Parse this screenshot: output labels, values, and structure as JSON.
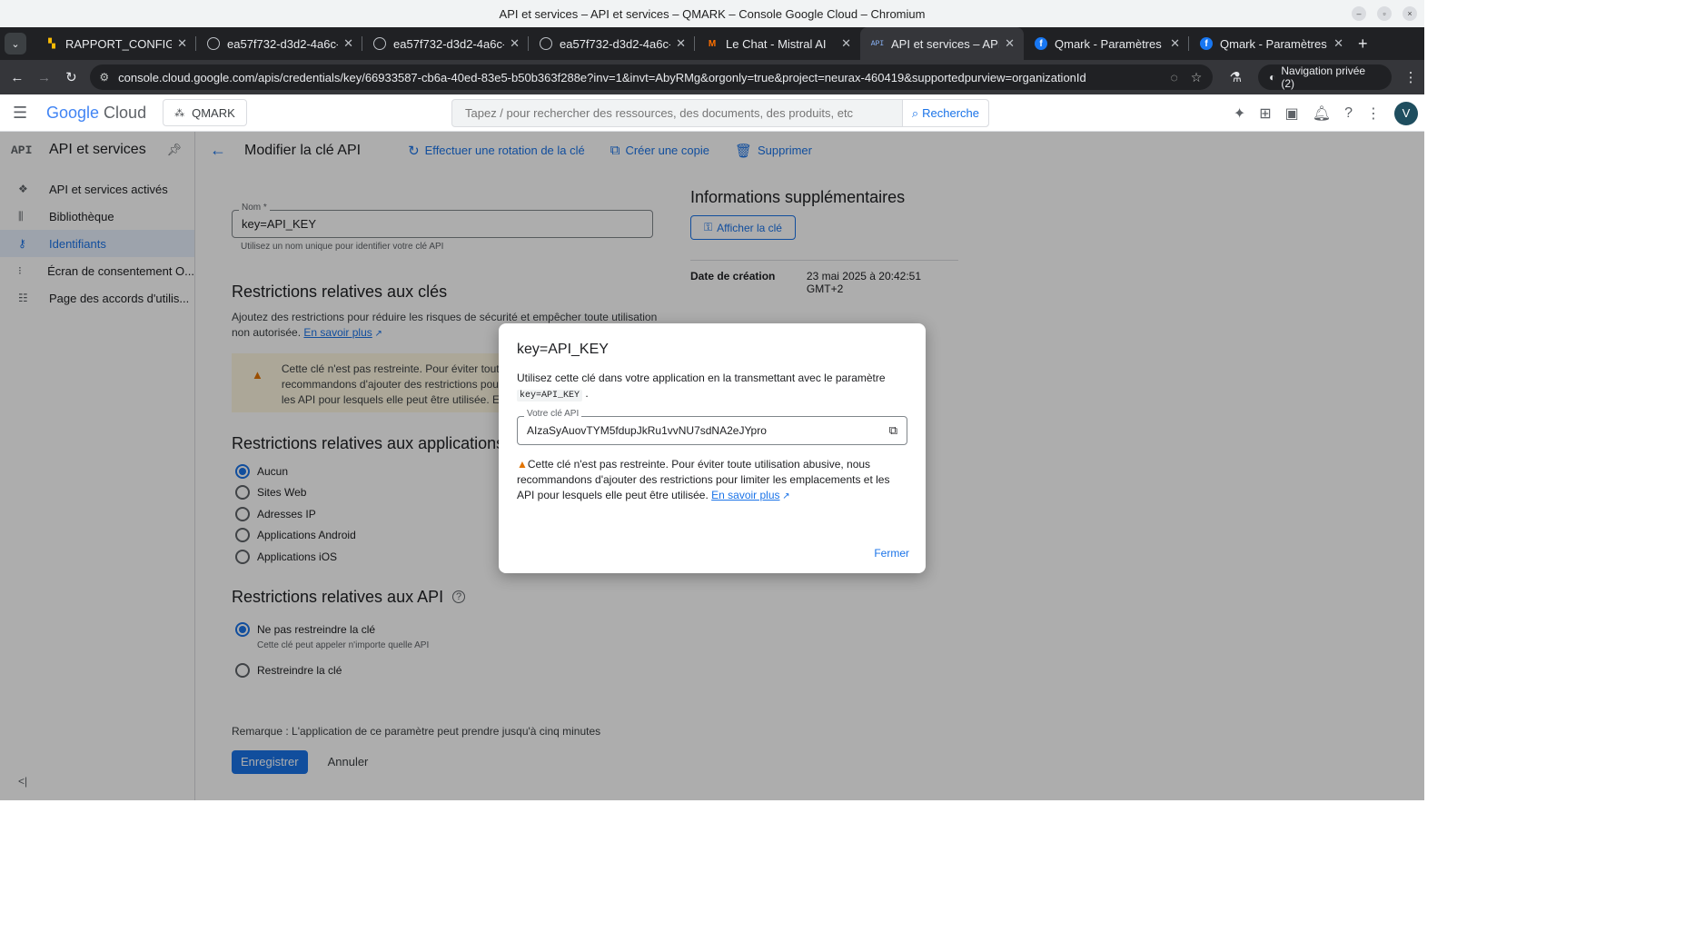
{
  "window": {
    "title": "API et services – API et services – QMARK – Console Google Cloud – Chromium"
  },
  "tabs": [
    {
      "label": "RAPPORT_CONFIGUR",
      "icon": "app-icon"
    },
    {
      "label": "ea57f732-d3d2-4a6c-",
      "icon": "globe-icon"
    },
    {
      "label": "ea57f732-d3d2-4a6c-",
      "icon": "globe-icon"
    },
    {
      "label": "ea57f732-d3d2-4a6c-",
      "icon": "globe-icon"
    },
    {
      "label": "Le Chat - Mistral AI",
      "icon": "mistral-icon"
    },
    {
      "label": "API et services – API e",
      "icon": "api-icon",
      "active": true
    },
    {
      "label": "Qmark - Paramètres d",
      "icon": "facebook-icon"
    },
    {
      "label": "Qmark - Paramètres d",
      "icon": "facebook-icon"
    }
  ],
  "address": {
    "url": "console.cloud.google.com/apis/credentials/key/66933587-cb6a-40ed-83e5-b50b363f288e?inv=1&invt=AbyRMg&orgonly=true&project=neurax-460419&supportedpurview=organizationId",
    "incognito": "Navigation privée (2)"
  },
  "header": {
    "logo_google": "Google",
    "logo_cloud": "Cloud",
    "project": "QMARK",
    "search_placeholder": "Tapez / pour rechercher des ressources, des documents, des produits, etc",
    "search_button": "Recherche",
    "avatar": "V"
  },
  "sidebar": {
    "badge": "API",
    "title": "API et services",
    "items": [
      {
        "label": "API et services activés",
        "icon": "diamond-icon"
      },
      {
        "label": "Bibliothèque",
        "icon": "library-icon"
      },
      {
        "label": "Identifiants",
        "icon": "key-icon",
        "active": true
      },
      {
        "label": "Écran de consentement O...",
        "icon": "consent-icon"
      },
      {
        "label": "Page des accords d'utilis...",
        "icon": "settings-list-icon"
      }
    ]
  },
  "page": {
    "title": "Modifier la clé API",
    "actions": {
      "rotate": "Effectuer une rotation de la clé",
      "copy": "Créer une copie",
      "delete": "Supprimer"
    },
    "name_label": "Nom *",
    "name_value": "key=API_KEY",
    "name_hint": "Utilisez un nom unique pour identifier votre clé API",
    "key_restrictions_title": "Restrictions relatives aux clés",
    "key_restrictions_desc": "Ajoutez des restrictions pour réduire les risques de sécurité et empêcher toute utilisation non autorisée.",
    "learn_more": "En savoir plus",
    "warning_text": "Cette clé n'est pas restreinte. Pour éviter toute utilisation abusive, nous recommandons d'ajouter des restrictions pour limiter les emplacements et les API pour lesquels elle peut être utilisée. En savoir plus",
    "app_restrictions_title": "Restrictions relatives aux applications",
    "app_options": [
      "Aucun",
      "Sites Web",
      "Adresses IP",
      "Applications Android",
      "Applications iOS"
    ],
    "app_selected": "Aucun",
    "api_restrictions_title": "Restrictions relatives aux API",
    "api_option_none": "Ne pas restreindre la clé",
    "api_option_none_sub": "Cette clé peut appeler n'importe quelle API",
    "api_option_restrict": "Restreindre la clé",
    "remark": "Remarque : L'application de ce paramètre peut prendre jusqu'à cinq minutes",
    "save": "Enregistrer",
    "cancel": "Annuler"
  },
  "info": {
    "title": "Informations supplémentaires",
    "show_key": "Afficher la clé",
    "created_label": "Date de création",
    "created_value": "23 mai 2025 à 20:42:51 GMT+2"
  },
  "dialog": {
    "title": "key=API_KEY",
    "text": "Utilisez cette clé dans votre application en la transmettant avec le paramètre",
    "param": "key=API_KEY",
    "key_label": "Votre clé API",
    "key_value": "AIzaSyAuovTYM5fdupJkRu1vvNU7sdNA2eJYpro",
    "warning": "Cette clé n'est pas restreinte. Pour éviter toute utilisation abusive, nous recommandons d'ajouter des restrictions pour limiter les emplacements et les API pour lesquels elle peut être utilisée.",
    "learn_more": "En savoir plus",
    "close": "Fermer"
  },
  "colors": {
    "accent": "#1a73e8",
    "warning": "#e37400",
    "tabbar": "#202124"
  }
}
